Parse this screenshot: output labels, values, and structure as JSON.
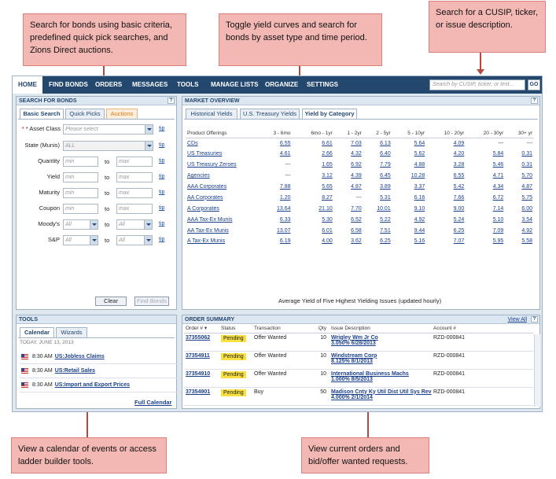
{
  "callouts": {
    "search_basic": "Search for bonds using basic criteria, predefined quick pick searches, and Zions Direct auctions.",
    "toggle_yield": "Toggle yield curves and search for bonds by asset type and time period.",
    "cusip": "Search for a CUSIP, ticker, or issue description.",
    "calendar": "View a calendar of events or access ladder builder tools.",
    "orders": "View current orders and bid/offer wanted requests."
  },
  "nav": {
    "tabs": [
      "HOME",
      "FIND BONDS",
      "ORDERS",
      "MESSAGES",
      "TOOLS",
      "MANAGE LISTS",
      "ORGANIZE",
      "SETTINGS"
    ],
    "search_placeholder": "Search by CUSIP, ticker, or text...",
    "go": "GO"
  },
  "search_panel": {
    "title": "SEARCH FOR BONDS",
    "help": "?",
    "tabs": [
      "Basic Search",
      "Quick Picks",
      "Auctions"
    ],
    "asset_class_label": "* Asset Class",
    "asset_class_value": "Please select",
    "state_label": "State (Munis)",
    "state_value": "ALL",
    "quantity_label": "Quantity",
    "yield_label": "Yield",
    "maturity_label": "Maturity",
    "coupon_label": "Coupon",
    "moodys_label": "Moody's",
    "sp_label": "S&P",
    "min": "min",
    "max": "max",
    "all": "All",
    "to": "to",
    "tip": "tip",
    "clear": "Clear",
    "find": "Find Bonds"
  },
  "market_panel": {
    "title": "MARKET OVERVIEW",
    "help": "?",
    "tabs": [
      "Historical Yields",
      "U.S. Treasury Yields",
      "Yield by Category"
    ],
    "columns": [
      "Product Offerings",
      "3 - 6mo",
      "6mo - 1yr",
      "1 - 2yr",
      "2 - 5yr",
      "5 - 10yr",
      "10 - 20yr",
      "20 - 30yr",
      "30+ yr"
    ],
    "rows": [
      [
        "CDs",
        "6.55",
        "6.61",
        "7.03",
        "6.13",
        "5.64",
        "4.09",
        "---",
        "---"
      ],
      [
        "US Treasuries",
        "4.61",
        "2.66",
        "4.32",
        "6.40",
        "5.62",
        "4.20",
        "5.84",
        "0.31"
      ],
      [
        "US Treasury Zeroes",
        "---",
        "1.65",
        "6.92",
        "7.79",
        "4.88",
        "3.28",
        "5.46",
        "0.31"
      ],
      [
        "Agencies",
        "---",
        "3.12",
        "4.39",
        "6.45",
        "10.28",
        "6.55",
        "4.71",
        "5.70"
      ],
      [
        "AAA Corporates",
        "7.88",
        "5.65",
        "4.87",
        "3.89",
        "3.37",
        "5.42",
        "4.34",
        "4.87"
      ],
      [
        "AA Corporates",
        "1.20",
        "8.27",
        "---",
        "5.31",
        "6.16",
        "7.66",
        "6.72",
        "5.75"
      ],
      [
        "A Corporates",
        "13.64",
        "21.10",
        "7.70",
        "10.01",
        "9.10",
        "9.00",
        "7.14",
        "6.00"
      ],
      [
        "AAA Tax-Ex Munis",
        "6.33",
        "5.30",
        "6.52",
        "5.22",
        "4.92",
        "5.24",
        "5.10",
        "3.54"
      ],
      [
        "AA Tax-Ex Munis",
        "13.07",
        "6.01",
        "6.58",
        "7.51",
        "9.44",
        "6.25",
        "7.09",
        "4.92"
      ],
      [
        "A Tax-Ex Munis",
        "6.19",
        "4.00",
        "3.62",
        "6.25",
        "5.16",
        "7.07",
        "5.95",
        "5.58"
      ]
    ],
    "footer": "Average Yield of Five Highest Yielding Issues (updated hourly)"
  },
  "tools_panel": {
    "title": "TOOLS",
    "tabs": [
      "Calendar",
      "Wizards"
    ],
    "date": "TODAY, JUNE 13, 2013",
    "events": [
      {
        "time": "8:30 AM",
        "label": "US:Jobless Claims"
      },
      {
        "time": "8:30 AM",
        "label": "US:Retail Sales"
      },
      {
        "time": "8:30 AM",
        "label": "US:Import and Export Prices"
      }
    ],
    "full_calendar": "Full Calendar"
  },
  "orders_panel": {
    "title": "ORDER SUMMARY",
    "view_all": "View All",
    "help": "?",
    "columns": [
      "Order # ▾",
      "Status",
      "Transaction",
      "Qty",
      "Issue Description",
      "Account #"
    ],
    "rows": [
      {
        "order": "37355062",
        "status": "Pending",
        "transaction": "Offer Wanted",
        "qty": "10",
        "desc1": "Wrigley Wm Jr Co",
        "desc2": "3.050% 6/28/2013",
        "account": "RZD-000841"
      },
      {
        "order": "37354911",
        "status": "Pending",
        "transaction": "Offer Wanted",
        "qty": "10",
        "desc1": "Windstream Corp",
        "desc2": "8.125% 8/1/2013",
        "account": "RZD-000841"
      },
      {
        "order": "37354910",
        "status": "Pending",
        "transaction": "Offer Wanted",
        "qty": "10",
        "desc1": "International Business Machs",
        "desc2": "1.000% 8/5/2013",
        "account": "RZD-000841"
      },
      {
        "order": "37354901",
        "status": "Pending",
        "transaction": "Buy",
        "qty": "50",
        "desc1": "Madison Cnty Ky Util Dist Util Sys Rev",
        "desc2": "4.000% 2/1/2014",
        "account": "RZD-000841"
      }
    ]
  }
}
